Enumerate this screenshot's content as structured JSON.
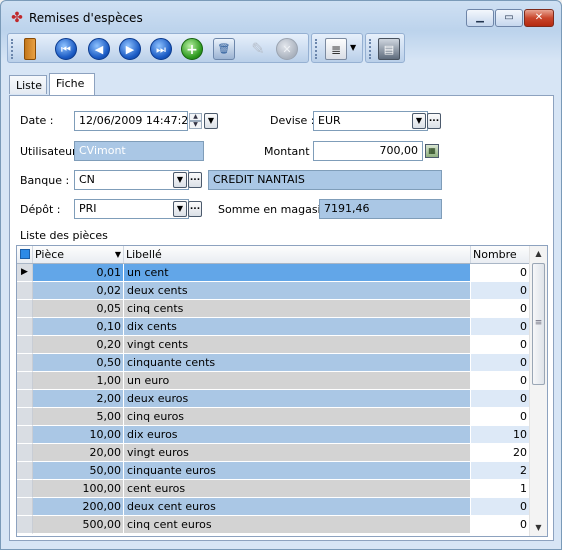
{
  "window": {
    "title": "Remises d'espèces"
  },
  "tabs": [
    {
      "label": "Liste"
    },
    {
      "label": "Fiche"
    }
  ],
  "form": {
    "date_label": "Date :",
    "date_value": "12/06/2009 14:47:25",
    "devise_label": "Devise :",
    "devise_value": "EUR",
    "utilisateur_label": "Utilisateur :",
    "utilisateur_value": "CVimont",
    "montant_label": "Montant :",
    "montant_value": "700,00",
    "banque_label": "Banque :",
    "banque_code": "CN",
    "banque_name": "CREDIT NANTAIS",
    "depot_label": "Dépôt :",
    "depot_code": "PRI",
    "somme_label": "Somme en magasin :",
    "somme_value": "7191,46"
  },
  "grid": {
    "title": "Liste des pièces",
    "headers": {
      "piece": "Pièce",
      "libelle": "Libellé",
      "nombre": "Nombre"
    },
    "rows": [
      {
        "piece": "0,01",
        "libelle": "un  cent",
        "nombre": "0"
      },
      {
        "piece": "0,02",
        "libelle": "deux  cents",
        "nombre": "0"
      },
      {
        "piece": "0,05",
        "libelle": "cinq  cents",
        "nombre": "0"
      },
      {
        "piece": "0,10",
        "libelle": "dix  cents",
        "nombre": "0"
      },
      {
        "piece": "0,20",
        "libelle": "vingt  cents",
        "nombre": "0"
      },
      {
        "piece": "0,50",
        "libelle": "cinquante  cents",
        "nombre": "0"
      },
      {
        "piece": "1,00",
        "libelle": "un euro",
        "nombre": "0"
      },
      {
        "piece": "2,00",
        "libelle": "deux euros",
        "nombre": "0"
      },
      {
        "piece": "5,00",
        "libelle": "cinq euros",
        "nombre": "0"
      },
      {
        "piece": "10,00",
        "libelle": "dix euros",
        "nombre": "10"
      },
      {
        "piece": "20,00",
        "libelle": "vingt euros",
        "nombre": "20"
      },
      {
        "piece": "50,00",
        "libelle": "cinquante euros",
        "nombre": "2"
      },
      {
        "piece": "100,00",
        "libelle": "cent euros",
        "nombre": "1"
      },
      {
        "piece": "200,00",
        "libelle": "deux cent euros",
        "nombre": "0"
      },
      {
        "piece": "500,00",
        "libelle": "cinq cent euros",
        "nombre": "0"
      }
    ]
  },
  "colors": {
    "row_odd": "#d3d3d3",
    "row_even": "#aac7e5",
    "row_selected": "#62a6e8",
    "nombre_odd": "#ffffff",
    "nombre_even": "#dde9f7"
  }
}
